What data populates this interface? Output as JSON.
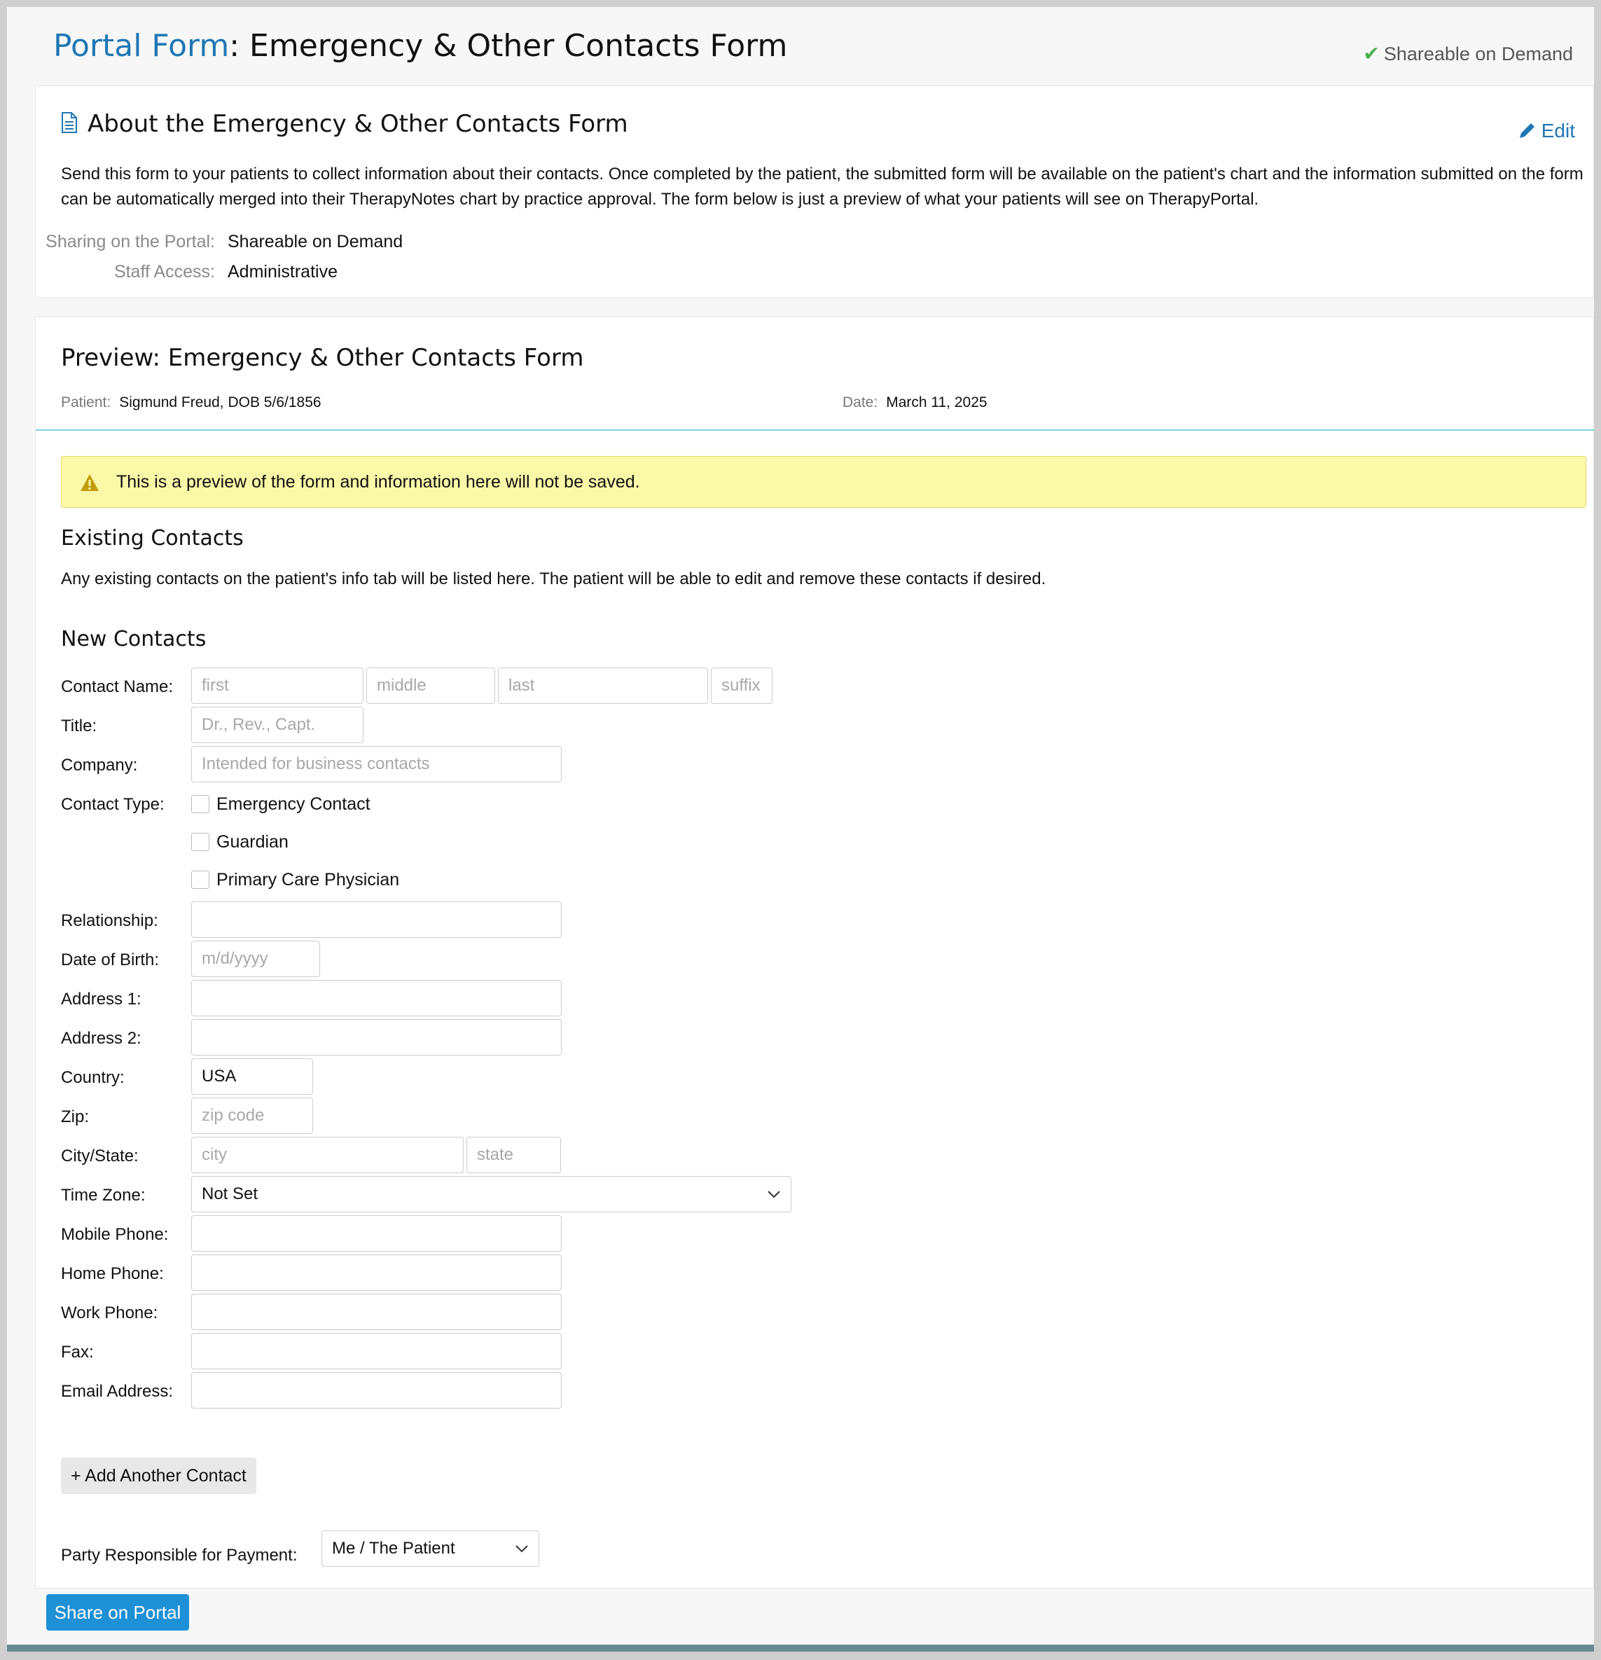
{
  "header": {
    "title_lead": "Portal Form",
    "title_rest": ": Emergency & Other Contacts Form",
    "share_status": "Shareable on Demand"
  },
  "about": {
    "title": "About the Emergency & Other Contacts Form",
    "edit_label": "Edit",
    "description": "Send this form to your patients to collect information about their contacts. Once completed by the patient, the submitted form will be available on the patient's chart and the information submitted on the form can be automatically merged into their TherapyNotes chart by practice approval. The form below is just a preview of what your patients will see on TherapyPortal.",
    "sharing_label": "Sharing on the Portal:",
    "sharing_value": "Shareable on Demand",
    "staff_label": "Staff Access:",
    "staff_value": "Administrative"
  },
  "preview": {
    "title": "Preview: Emergency & Other Contacts Form",
    "patient_label": "Patient:",
    "patient_value": "Sigmund Freud, DOB 5/6/1856",
    "date_label": "Date:",
    "date_value": "March 11, 2025",
    "warning": "This is a preview of the form and information here will not be saved.",
    "existing_title": "Existing Contacts",
    "existing_text": "Any existing contacts on the patient's info tab will be listed here. The patient will be able to edit and remove these contacts if desired.",
    "new_title": "New Contacts"
  },
  "form": {
    "contact_name_label": "Contact Name:",
    "first_ph": "first",
    "middle_ph": "middle",
    "last_ph": "last",
    "suffix_ph": "suffix",
    "title_label": "Title:",
    "title_ph": "Dr., Rev., Capt.",
    "company_label": "Company:",
    "company_ph": "Intended for business contacts",
    "contact_type_label": "Contact Type:",
    "contact_types": [
      "Emergency Contact",
      "Guardian",
      "Primary Care Physician"
    ],
    "relationship_label": "Relationship:",
    "dob_label": "Date of Birth:",
    "dob_ph": "m/d/yyyy",
    "address1_label": "Address 1:",
    "address2_label": "Address 2:",
    "country_label": "Country:",
    "country_value": "USA",
    "zip_label": "Zip:",
    "zip_ph": "zip code",
    "city_state_label": "City/State:",
    "city_ph": "city",
    "state_ph": "state",
    "time_zone_label": "Time Zone:",
    "time_zone_value": "Not Set",
    "mobile_label": "Mobile Phone:",
    "home_label": "Home Phone:",
    "work_label": "Work Phone:",
    "fax_label": "Fax:",
    "email_label": "Email Address:",
    "add_contact": "+ Add Another Contact",
    "payment_label": "Party Responsible for Payment:",
    "payment_value": "Me / The Patient"
  },
  "footer": {
    "share_button": "Share on Portal"
  },
  "colors": {
    "accent": "#1f77b4",
    "share_button": "#1e90d6",
    "warning_bg": "#fbf8a8",
    "check": "#4caf50"
  },
  "icons": [
    "check-icon",
    "document-icon",
    "pencil-icon",
    "warning-icon",
    "chevron-down-icon"
  ]
}
